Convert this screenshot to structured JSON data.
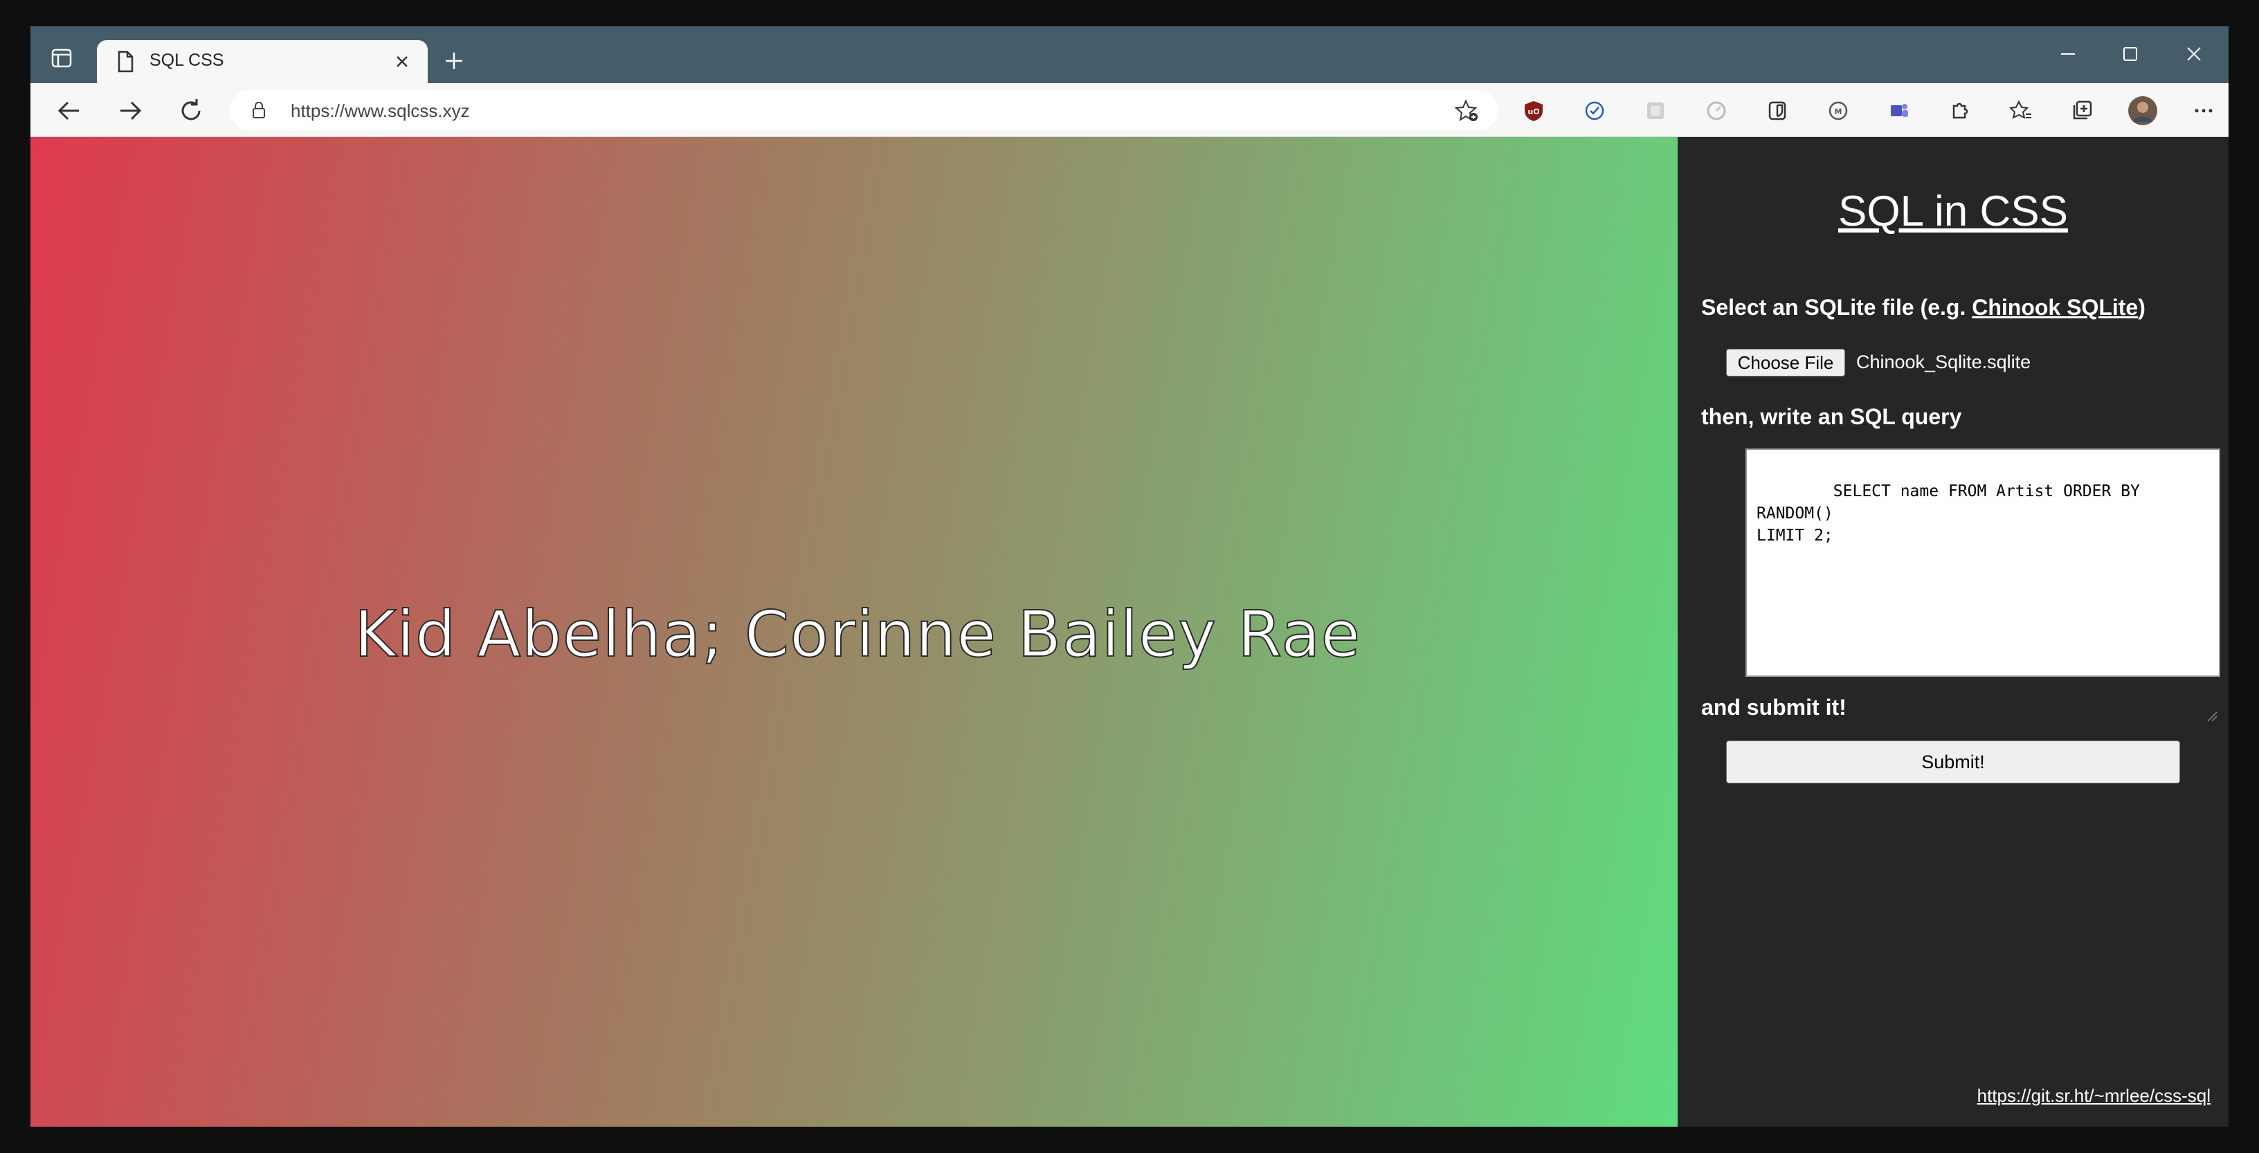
{
  "browser": {
    "tab_title": "SQL CSS",
    "url": "https://www.sqlcss.xyz",
    "extensions": [
      "ublock-icon",
      "check-circle-icon",
      "grid-icon",
      "speedometer-icon",
      "bitwarden-icon",
      "metamask-icon",
      "teams-icon",
      "puzzle-icon",
      "favorites-icon",
      "collections-icon",
      "avatar",
      "more-icon"
    ],
    "colors": {
      "titlebar": "#455d6b",
      "toolbar": "#f7f7f7"
    }
  },
  "viewport": {
    "result_text": "Kid Abelha; Corinne Bailey Rae",
    "gradient_start": "#de3a4e",
    "gradient_end": "#5fdc80"
  },
  "panel": {
    "title": "SQL in CSS",
    "select_label_prefix": "Select an SQLite file (e.g. ",
    "select_link": "Chinook SQLite",
    "select_label_suffix": ")",
    "choose_file_label": "Choose File",
    "file_name": "Chinook_Sqlite.sqlite",
    "write_label": "then, write an SQL query",
    "query": "SELECT name FROM Artist ORDER BY RANDOM()\nLIMIT 2;",
    "submit_label": "and submit it!",
    "submit_button": "Submit!",
    "footer_link": "https://git.sr.ht/~mrlee/css-sql",
    "background": "#262626"
  }
}
